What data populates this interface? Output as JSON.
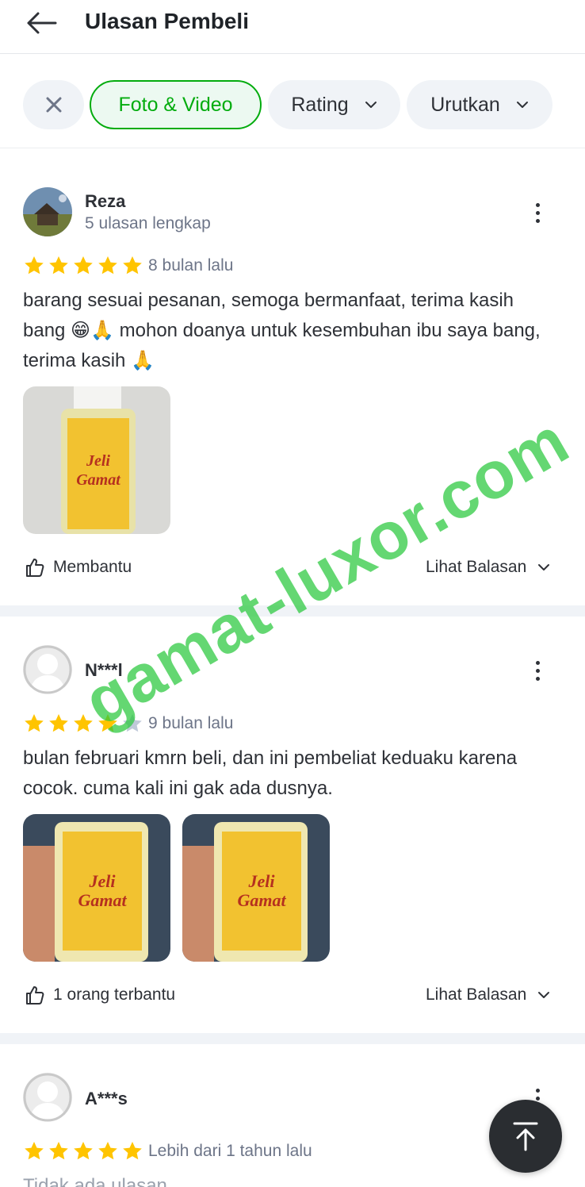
{
  "header": {
    "title": "Ulasan Pembeli",
    "back_icon": "arrow-left-icon"
  },
  "filters": {
    "close_icon": "close-icon",
    "foto_video": "Foto & Video",
    "rating": "Rating",
    "urutkan": "Urutkan"
  },
  "colors": {
    "accent": "#03ac0e",
    "star": "#ffc400",
    "star_empty": "#bfc9d9",
    "divider": "#f0f3f7"
  },
  "reviews": [
    {
      "name": "Reza",
      "sub": "5 ulasan lengkap",
      "rating": 5,
      "time": "8 bulan lalu",
      "text": "barang sesuai pesanan, semoga bermanfaat, terima kasih bang 😁🙏 mohon doanya untuk kesembuhan ibu saya bang, terima kasih 🙏",
      "helpful": "Membantu",
      "replies": "Lihat Balasan"
    },
    {
      "name": "N***l",
      "rating": 4,
      "time": "9 bulan lalu",
      "text": "bulan februari kmrn beli, dan ini pembeliat keduaku karena cocok. cuma kali ini gak ada dusnya.",
      "helpful": "1 orang terbantu",
      "replies": "Lihat Balasan"
    },
    {
      "name": "A***s",
      "rating": 5,
      "time": "Lebih dari 1 tahun lalu",
      "text": "Tidak ada ulasan"
    }
  ],
  "watermark": "gamat-luxor.com"
}
